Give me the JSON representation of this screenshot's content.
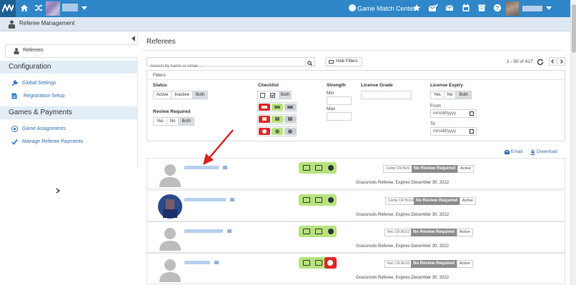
{
  "topbar": {
    "game_match_center": "Game Match Center",
    "colors": {
      "primary": "#2f86c8",
      "logo_bg": "#1e5f92"
    },
    "icons": [
      "home-icon",
      "shuffle-icon",
      "star-icon",
      "mail-check-icon",
      "envelope-icon",
      "calendar-icon",
      "archive-icon",
      "help-icon"
    ]
  },
  "subbar": {
    "title": "Referee Management"
  },
  "sidebar": {
    "active_item": "Referees",
    "sections": [
      {
        "label": "Configuration",
        "items": [
          "Global Settings",
          "Registration Setup"
        ]
      },
      {
        "label": "Games & Payments",
        "items": [
          "Game Assignments",
          "Manage Referee Payments"
        ]
      }
    ]
  },
  "main": {
    "title": "Referees",
    "search_placeholder": "Search by name or email...",
    "hide_filters": "Hide Filters",
    "pager": "1 - 50 of 417",
    "email": "Email",
    "download": "Download"
  },
  "filters": {
    "header": "Filters",
    "status": {
      "label": "Status",
      "options": [
        "Active",
        "Inactive",
        "Both"
      ],
      "selected": "Both"
    },
    "review": {
      "label": "Review Required",
      "options": [
        "Yes",
        "No",
        "Both"
      ],
      "selected": "Both"
    },
    "checklist": {
      "label": "Checklist",
      "both": "Both"
    },
    "strength": {
      "label": "Strength",
      "min": "Min",
      "max": "Max"
    },
    "license_grade": {
      "label": "License Grade"
    },
    "license_expiry": {
      "label": "License Expiry",
      "options": [
        "Yes",
        "No",
        "Both"
      ],
      "selected": "Both",
      "from": "From",
      "to": "To",
      "date_placeholder": "mm/dd/yyyy"
    }
  },
  "referees": [
    {
      "comp": "Comp CR BU9",
      "review": "No Review Required",
      "status": "Active",
      "desc": "Grassroots Referee, Expires December 30, 2022",
      "alert": false
    },
    {
      "comp": "Comp CR BU14",
      "review": "No Review Required",
      "status": "Active",
      "desc": "Grassroots Referee, Expires December 30, 2022",
      "alert": false
    },
    {
      "comp": "Rec CR BU12",
      "review": "No Review Required",
      "status": "Active",
      "desc": "Grassroots Referee, Expires December 30, 2022",
      "alert": false
    },
    {
      "comp": "Rec CR BU12",
      "review": "No Review Required",
      "status": "Active",
      "desc": "Grassroots Referee, Expires December 30, 2022",
      "alert": true
    }
  ]
}
